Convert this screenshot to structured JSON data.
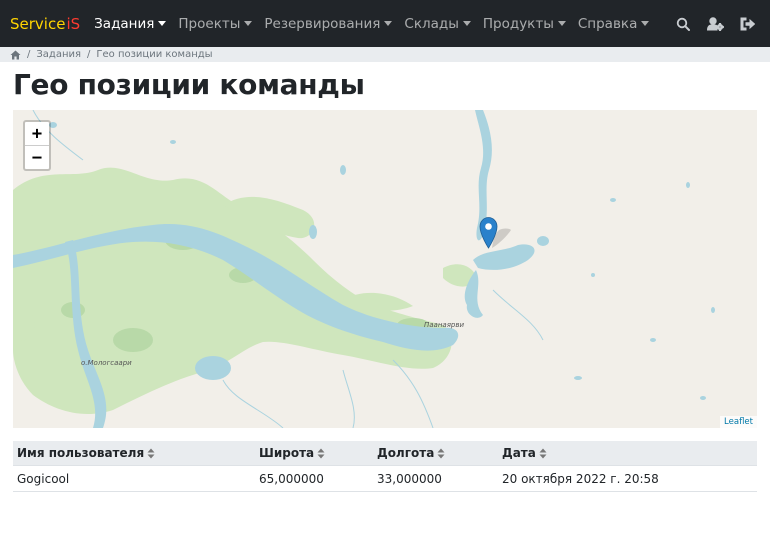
{
  "navbar": {
    "brand": "Service",
    "brand_suffix": "iS",
    "menu": [
      {
        "label": "Задания",
        "active": true
      },
      {
        "label": "Проекты",
        "active": false
      },
      {
        "label": "Резервирования",
        "active": false
      },
      {
        "label": "Склады",
        "active": false
      },
      {
        "label": "Продукты",
        "active": false
      },
      {
        "label": "Справка",
        "active": false
      }
    ],
    "icons": [
      "search-icon",
      "user-settings-icon",
      "logout-icon"
    ]
  },
  "breadcrumb": {
    "home_icon": "home-icon",
    "items": [
      "Задания",
      "Гео позиции команды"
    ]
  },
  "page": {
    "title": "Гео позиции команды"
  },
  "map": {
    "zoom_in": "+",
    "zoom_out": "−",
    "attribution": "Leaflet",
    "labels": {
      "town": "Паанаярви",
      "village": "о.Мологсаари"
    },
    "marker_color": "#2a81cb"
  },
  "table": {
    "headers": [
      "Имя пользователя",
      "Широта",
      "Долгота",
      "Дата"
    ],
    "rows": [
      [
        "Gogicool",
        "65,000000",
        "33,000000",
        "20 октября 2022 г. 20:58"
      ]
    ]
  },
  "colors": {
    "navbar": "#212529",
    "brand": "#ffd400",
    "brand_suffix": "#ff3b30",
    "water": "#aad3df",
    "forest": "#cfe6bd",
    "land": "#f2efe9"
  }
}
